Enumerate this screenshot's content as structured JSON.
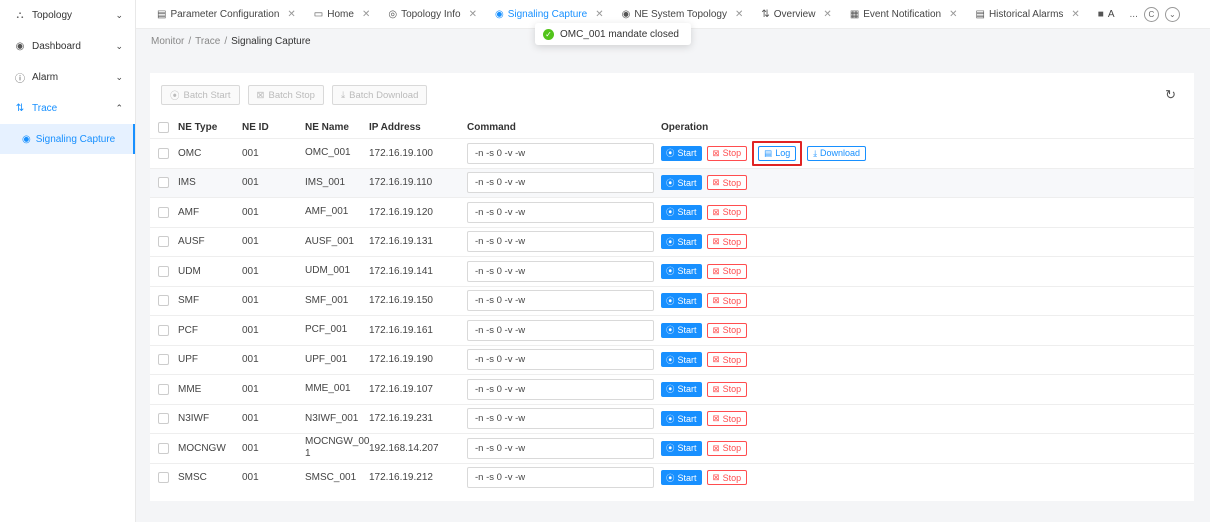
{
  "sidebar": {
    "items": [
      {
        "label": "Topology",
        "icon": "topology-icon",
        "glyph": "⛬",
        "chevron": "⌄"
      },
      {
        "label": "Dashboard",
        "icon": "dashboard-icon",
        "glyph": "◉",
        "chevron": "⌄"
      },
      {
        "label": "Alarm",
        "icon": "alarm-icon",
        "glyph": "ⓘ",
        "chevron": "⌄"
      },
      {
        "label": "Trace",
        "icon": "trace-icon",
        "glyph": "⇅",
        "chevron": "⌃"
      }
    ],
    "sub": {
      "label": "Signaling Capture",
      "glyph": "◉"
    }
  },
  "tabs": [
    {
      "label": "Parameter Configuration",
      "glyph": "▤",
      "close": "✕"
    },
    {
      "label": "Home",
      "glyph": "▭",
      "close": "✕"
    },
    {
      "label": "Topology Info",
      "glyph": "◎",
      "close": "✕"
    },
    {
      "label": "Signaling Capture",
      "glyph": "◉",
      "close": "✕"
    },
    {
      "label": "NE System Topology",
      "glyph": "◉",
      "close": "✕"
    },
    {
      "label": "Overview",
      "glyph": "⇅",
      "close": "✕"
    },
    {
      "label": "Event Notification",
      "glyph": "▦",
      "close": "✕"
    },
    {
      "label": "Historical Alarms",
      "glyph": "▤",
      "close": "✕"
    },
    {
      "label": "A",
      "glyph": "■",
      "close": ""
    }
  ],
  "tab_more": "...",
  "tab_round_1": "C",
  "tab_round_2": "⌄",
  "breadcrumb": {
    "a": "Monitor",
    "b": "Trace",
    "c": "Signaling Capture",
    "sep": "/"
  },
  "toast": {
    "text": "OMC_001 mandate closed",
    "check": "✓"
  },
  "toolbar": {
    "batch_start": "Batch Start",
    "batch_stop": "Batch Stop",
    "batch_download": "Batch Download",
    "start_glyph": "⦿",
    "stop_glyph": "⊠",
    "download_glyph": "⤓",
    "refresh_glyph": "↻"
  },
  "table": {
    "headers": {
      "type": "NE Type",
      "id": "NE ID",
      "name": "NE Name",
      "ip": "IP Address",
      "cmd": "Command",
      "op": "Operation"
    },
    "start_label": "Start",
    "stop_label": "Stop",
    "log_label": "Log",
    "download_label": "Download",
    "rows": [
      {
        "type": "OMC",
        "id": "001",
        "name": "OMC_001",
        "ip": "172.16.19.100",
        "cmd": "-n -s 0 -v -w"
      },
      {
        "type": "IMS",
        "id": "001",
        "name": "IMS_001",
        "ip": "172.16.19.110",
        "cmd": "-n -s 0 -v -w"
      },
      {
        "type": "AMF",
        "id": "001",
        "name": "AMF_001",
        "ip": "172.16.19.120",
        "cmd": "-n -s 0 -v -w"
      },
      {
        "type": "AUSF",
        "id": "001",
        "name": "AUSF_001",
        "ip": "172.16.19.131",
        "cmd": "-n -s 0 -v -w"
      },
      {
        "type": "UDM",
        "id": "001",
        "name": "UDM_001",
        "ip": "172.16.19.141",
        "cmd": "-n -s 0 -v -w"
      },
      {
        "type": "SMF",
        "id": "001",
        "name": "SMF_001",
        "ip": "172.16.19.150",
        "cmd": "-n -s 0 -v -w"
      },
      {
        "type": "PCF",
        "id": "001",
        "name": "PCF_001",
        "ip": "172.16.19.161",
        "cmd": "-n -s 0 -v -w"
      },
      {
        "type": "UPF",
        "id": "001",
        "name": "UPF_001",
        "ip": "172.16.19.190",
        "cmd": "-n -s 0 -v -w"
      },
      {
        "type": "MME",
        "id": "001",
        "name": "MME_001",
        "ip": "172.16.19.107",
        "cmd": "-n -s 0 -v -w"
      },
      {
        "type": "N3IWF",
        "id": "001",
        "name": "N3IWF_001",
        "ip": "172.16.19.231",
        "cmd": "-n -s 0 -v -w"
      },
      {
        "type": "MOCNGW",
        "id": "001",
        "name": "MOCNGW_00\n1",
        "ip": "192.168.14.207",
        "cmd": "-n -s 0 -v -w"
      },
      {
        "type": "SMSC",
        "id": "001",
        "name": "SMSC_001",
        "ip": "172.16.19.212",
        "cmd": "-n -s 0 -v -w"
      }
    ]
  }
}
